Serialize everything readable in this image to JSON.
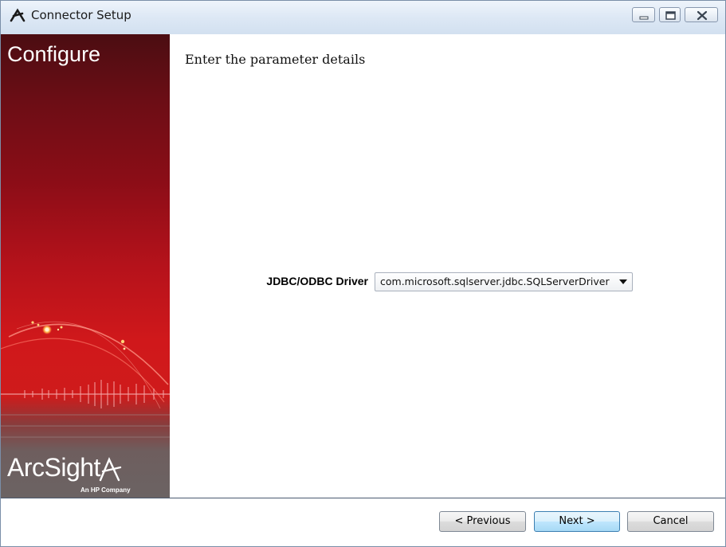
{
  "window": {
    "title": "Connector Setup",
    "icon": "arcsight-logo-icon",
    "controls": [
      "minimize-icon",
      "maximize-icon",
      "close-icon"
    ]
  },
  "sidebar": {
    "title": "Configure",
    "logo_text": "ArcSight",
    "logo_subtitle": "An HP Company"
  },
  "main": {
    "heading": "Enter the parameter details",
    "field": {
      "label": "JDBC/ODBC Driver",
      "value": "com.microsoft.sqlserver.jdbc.SQLServerDriver"
    }
  },
  "buttons": {
    "previous": "< Previous",
    "next": "Next >",
    "cancel": "Cancel"
  },
  "colors": {
    "sidebar_red": "#d0181b",
    "sidebar_dark": "#4b0d12",
    "accent_blue": "#3c7fb1"
  }
}
